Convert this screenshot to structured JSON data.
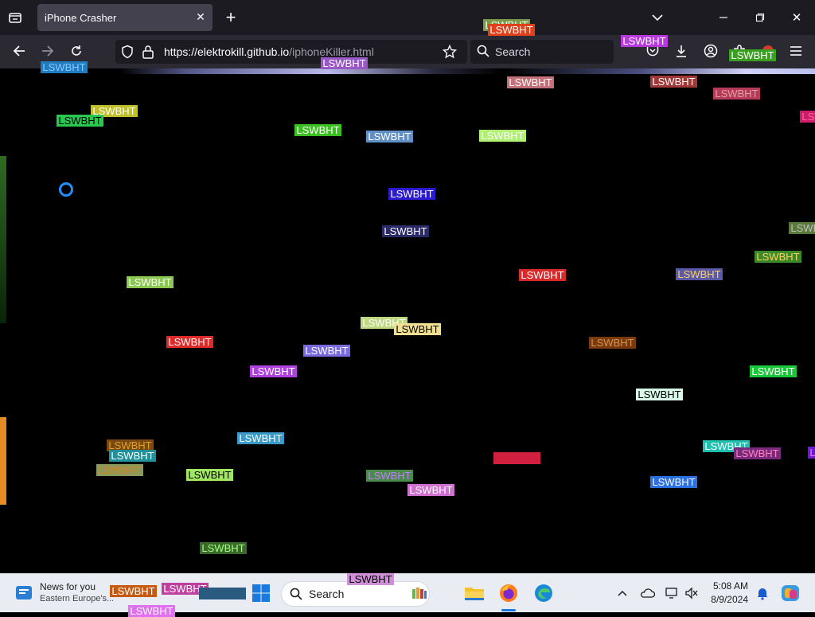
{
  "browser": {
    "tab_title": "iPhone Crasher",
    "url_domain": "https://elektrokill.github.io",
    "url_path": "/iphoneKiller.html",
    "search_placeholder": "Search"
  },
  "page": {
    "label_text": "LSWBHT",
    "labels": [
      {
        "text": "LSWBHT",
        "bg": "#7a9a4a",
        "fg": "#ffffff"
      },
      {
        "text": "LSWBHT",
        "bg": "#e0401a",
        "fg": "#ffffff"
      },
      {
        "text": "LSWBHT",
        "bg": "#b83adf",
        "fg": "#ffffff"
      },
      {
        "text": "LSWBHT",
        "bg": "#1f7cc0",
        "fg": "#8cc7ff"
      },
      {
        "text": "LSWBHT",
        "bg": "#9a58c6",
        "fg": "#ffffff"
      },
      {
        "text": "LSWBHT",
        "bg": "#c4707a",
        "fg": "#ffffff"
      },
      {
        "text": "LSWBHT",
        "bg": "#a03838",
        "fg": "#ffffff"
      },
      {
        "text": "LSWBHT",
        "bg": "#b63a5a",
        "fg": "#e0a0a0"
      },
      {
        "text": "LSWBHT",
        "bg": "#c0c02a",
        "fg": "#ffffff"
      },
      {
        "text": "LSWBHT",
        "bg": "#26c850",
        "fg": "#000000"
      },
      {
        "text": "LSWBHT",
        "bg": "#3ac020",
        "fg": "#ffffff"
      },
      {
        "text": "LSWBHT",
        "bg": "#6090c8",
        "fg": "#ffffff"
      },
      {
        "text": "LSWBHT",
        "bg": "#b0f070",
        "fg": "#ffffff"
      },
      {
        "text": "LSWBHT",
        "bg": "#d01a6a",
        "fg": "#ff6a9a"
      },
      {
        "text": "LSWBHT",
        "bg": "#2c1ad0",
        "fg": "#ffffff"
      },
      {
        "text": "LSWBHT",
        "bg": "#2a2a6a",
        "fg": "#ffffff"
      },
      {
        "text": "LSWBHT",
        "bg": "#5a7a3a",
        "fg": "#c0c0c0"
      },
      {
        "text": "LSWBHT",
        "bg": "#3a8a2a",
        "fg": "#ffd060"
      },
      {
        "text": "LSWBHT",
        "bg": "#8ac850",
        "fg": "#ffffff"
      },
      {
        "text": "LSWBHT",
        "bg": "#d82a2a",
        "fg": "#ffffff"
      },
      {
        "text": "LSWBHT",
        "bg": "#5a5aa8",
        "fg": "#ffd060"
      },
      {
        "text": "LSWBHT",
        "bg": "#c0d880",
        "fg": "#ffffff"
      },
      {
        "text": "LSWBHT",
        "bg": "#f0e090",
        "fg": "#000000"
      },
      {
        "text": "LSWBHT",
        "bg": "#e02a2a",
        "fg": "#ffffff"
      },
      {
        "text": "LSWBHT",
        "bg": "#7a6ae0",
        "fg": "#ffffff"
      },
      {
        "text": "LSWBHT",
        "bg": "#7a3a10",
        "fg": "#d89050"
      },
      {
        "text": "LSWBHT",
        "bg": "#b040e0",
        "fg": "#ffffff"
      },
      {
        "text": "LSWBHT",
        "bg": "#18c838",
        "fg": "#ffffff"
      },
      {
        "text": "LSWBHT",
        "bg": "#d8f8e8",
        "fg": "#000000"
      },
      {
        "text": "LSWBHT",
        "bg": "#7a4a10",
        "fg": "#e0a030"
      },
      {
        "text": "LSWBHT",
        "bg": "#3a9ac8",
        "fg": "#ffffff"
      },
      {
        "text": "LSWBHT",
        "bg": "#20c0b0",
        "fg": "#ffffff"
      },
      {
        "text": "LSWBHT",
        "bg": "#20909a",
        "fg": "#ffffff"
      },
      {
        "text": "LSWBHT",
        "bg": "#7a2a7a",
        "fg": "#ff80c0"
      },
      {
        "text": "LSWBHT",
        "bg": "#d02040",
        "fg": "#d02040"
      },
      {
        "text": "LSWBHT",
        "bg": "#8a9a5a",
        "fg": "#e08020"
      },
      {
        "text": "LSWBHT",
        "bg": "#a0e860",
        "fg": "#000000"
      },
      {
        "text": "LSWBHT",
        "bg": "#4a8a4a",
        "fg": "#c080ff"
      },
      {
        "text": "LSWBHT",
        "bg": "#d070d0",
        "fg": "#ffffff"
      },
      {
        "text": "LSWBHT",
        "bg": "#2a70e0",
        "fg": "#ffffff"
      },
      {
        "text": "LSWBHT",
        "bg": "#3a6a2a",
        "fg": "#a0ff80"
      },
      {
        "text": "LSWBHT",
        "bg": "#6a1ae0",
        "fg": "#ff70ff"
      },
      {
        "text": "LSWBHT",
        "bg": "#3aa020",
        "fg": "#ffffff"
      },
      {
        "text": "LSWBHT",
        "bg": "#7a7af0",
        "fg": "#ffffff"
      }
    ]
  },
  "taskbar": {
    "news_title": "News for you",
    "news_subtitle": "Eastern Europe's...",
    "search_placeholder": "Search",
    "time": "5:08 AM",
    "date": "8/9/2024",
    "overlay_labels": [
      {
        "text": "LSWBHT",
        "bg": "#c85a10",
        "fg": "#ffffff"
      },
      {
        "text": "LSWBHT",
        "bg": "#c040a0",
        "fg": "#ffffff"
      },
      {
        "text": "LSWBHT",
        "bg": "#2a5a80",
        "fg": "#2a5a80"
      },
      {
        "text": "LSWBHT",
        "bg": "#d090d8",
        "fg": "#000000"
      },
      {
        "text": "LSWBHT",
        "bg": "#e070f0",
        "fg": "#ffffff"
      }
    ]
  }
}
